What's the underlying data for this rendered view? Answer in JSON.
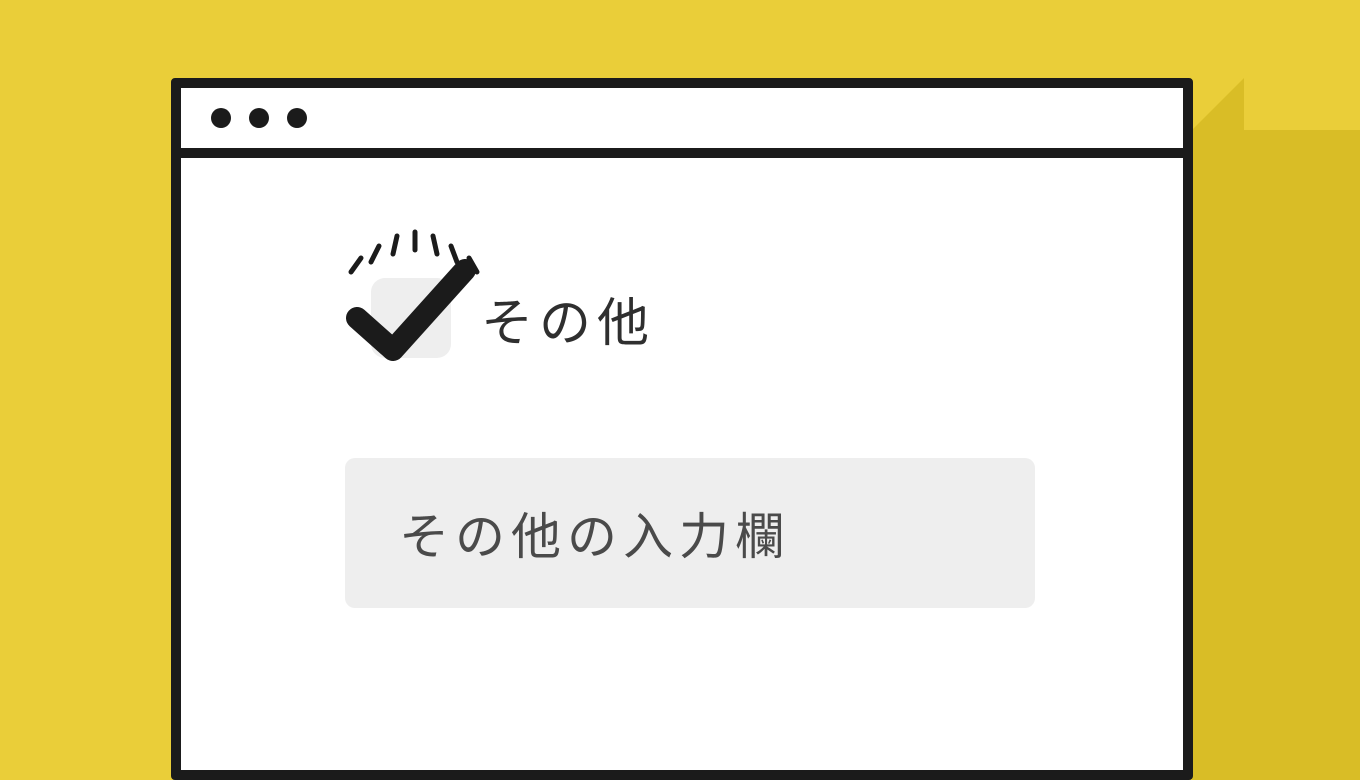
{
  "checkbox": {
    "label": "その他",
    "checked": true
  },
  "input": {
    "placeholder": "その他の入力欄"
  }
}
